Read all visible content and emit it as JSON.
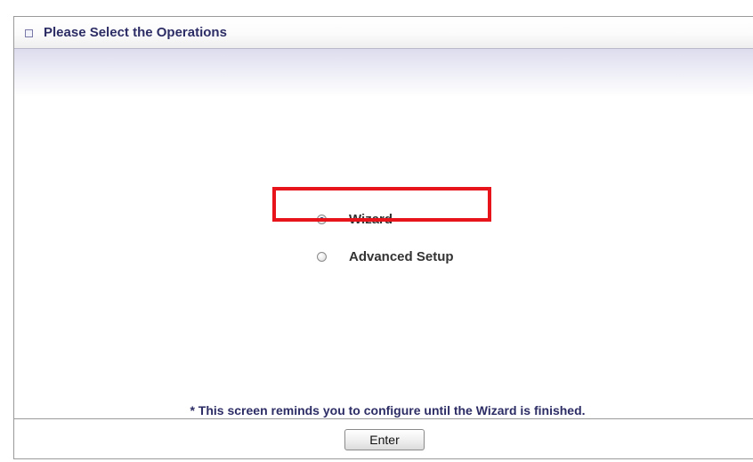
{
  "panel": {
    "title": "Please Select the Operations",
    "header_icon": "square-bullet-icon"
  },
  "options": [
    {
      "label": "Wizard",
      "selected": true
    },
    {
      "label": "Advanced Setup",
      "selected": false
    }
  ],
  "annotation": {
    "highlight_color": "#e8141b",
    "highlighted_option": "Wizard"
  },
  "note": "* This screen reminds you to configure until the Wizard is finished.",
  "buttons": {
    "enter_label": "Enter"
  },
  "colors": {
    "title_text": "#2d2d66",
    "header_shade": "#dcdcee"
  }
}
